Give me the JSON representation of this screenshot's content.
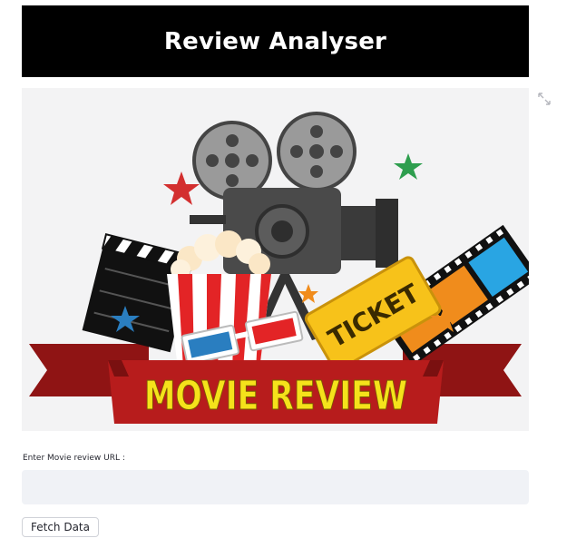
{
  "header": {
    "title": "Review Analyser"
  },
  "banner": {
    "headline": "MOVIE REVIEW",
    "ticket_text": "TICKET",
    "colors": {
      "ribbon": "#b71c1c",
      "headline": "#f5e21b",
      "ticket": "#f7c21a"
    }
  },
  "form": {
    "url_label": "Enter Movie review URL :",
    "url_value": "",
    "url_placeholder": "",
    "fetch_button_label": "Fetch Data"
  }
}
